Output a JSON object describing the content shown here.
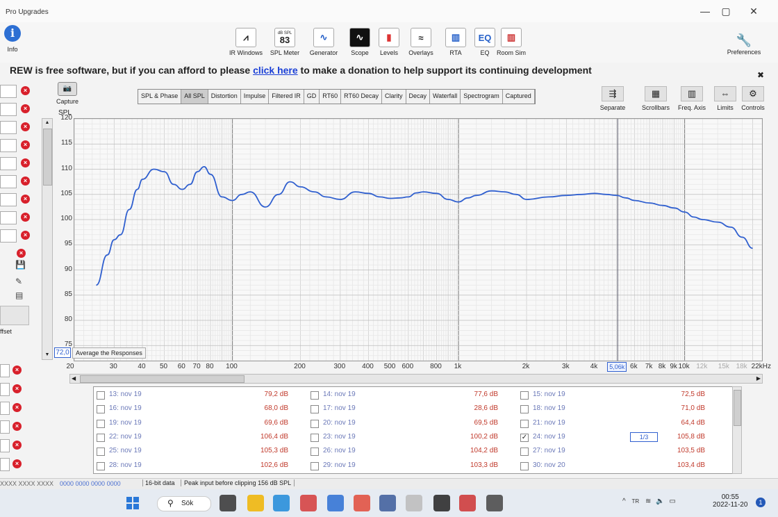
{
  "window": {
    "title": "Pro Upgrades",
    "minimize": "—",
    "maximize": "▢",
    "close": "✕"
  },
  "toolbar": {
    "info_label": "Info",
    "spl_meter": {
      "header": "dB SPL",
      "value": "83"
    },
    "items": [
      {
        "label": "IR Windows",
        "icon": "ir-windows-icon"
      },
      {
        "label": "SPL Meter",
        "icon": "spl-meter-icon"
      },
      {
        "label": "Generator",
        "icon": "generator-icon"
      },
      {
        "label": "Scope",
        "icon": "scope-icon"
      },
      {
        "label": "Levels",
        "icon": "levels-icon"
      },
      {
        "label": "Overlays",
        "icon": "overlays-icon"
      },
      {
        "label": "RTA",
        "icon": "rta-icon"
      },
      {
        "label": "EQ",
        "icon": "eq-icon"
      },
      {
        "label": "Room Sim",
        "icon": "room-sim-icon"
      }
    ],
    "preferences_label": "Preferences"
  },
  "banner": {
    "prefix": "REW is free software, but if you can afford to please ",
    "link": "click here",
    "suffix": " to make a donation to help support its continuing development",
    "close": "✖"
  },
  "capture_label": "Capture",
  "offset_label": "ffset",
  "tabs": [
    "SPL & Phase",
    "All SPL",
    "Distortion",
    "Impulse",
    "Filtered IR",
    "GD",
    "RT60",
    "RT60 Decay",
    "Clarity",
    "Decay",
    "Waterfall",
    "Spectrogram",
    "Captured"
  ],
  "active_tab": "All SPL",
  "right_tools": [
    "Separate",
    "Scrollbars",
    "Freq. Axis",
    "Limits",
    "Controls"
  ],
  "y_unit": "SPL",
  "y_offset_value": "72,0",
  "average_button": "Average the Responses",
  "cursor_freq": "5,06k",
  "table": {
    "rows": [
      [
        {
          "name": "13: nov 19",
          "value": "79,2 dB",
          "checked": false
        },
        {
          "name": "14: nov 19",
          "value": "77,6 dB",
          "checked": false
        },
        {
          "name": "15: nov 19",
          "value": "72,5 dB",
          "checked": false
        }
      ],
      [
        {
          "name": "16: nov 19",
          "value": "68,0 dB",
          "checked": false
        },
        {
          "name": "17: nov 19",
          "value": "28,6 dB",
          "checked": false
        },
        {
          "name": "18: nov 19",
          "value": "71,0 dB",
          "checked": false
        }
      ],
      [
        {
          "name": "19: nov 19",
          "value": "69,6 dB",
          "checked": false
        },
        {
          "name": "20: nov 19",
          "value": "69,5 dB",
          "checked": false
        },
        {
          "name": "21: nov 19",
          "value": "64,4 dB",
          "checked": false
        }
      ],
      [
        {
          "name": "22: nov 19",
          "value": "106,4 dB",
          "checked": false
        },
        {
          "name": "23: nov 19",
          "value": "100,2 dB",
          "checked": false
        },
        {
          "name": "24: nov 19",
          "value": "105,8 dB",
          "checked": true
        }
      ],
      [
        {
          "name": "25: nov 19",
          "value": "105,3 dB",
          "checked": false
        },
        {
          "name": "26: nov 19",
          "value": "104,2 dB",
          "checked": false
        },
        {
          "name": "27: nov 19",
          "value": "103,5 dB",
          "checked": false
        }
      ],
      [
        {
          "name": "28: nov 19",
          "value": "102,6 dB",
          "checked": false
        },
        {
          "name": "29: nov 19",
          "value": "103,3 dB",
          "checked": false
        },
        {
          "name": "30: nov 20",
          "value": "103,4 dB",
          "checked": false
        }
      ]
    ],
    "smoothing_badge": "1/3"
  },
  "status": {
    "bits": "0000 0000  0000 0000",
    "bitdepth": "16-bit data",
    "peak": "Peak input before clipping 156 dB SPL"
  },
  "taskbar": {
    "search_label": "Sök",
    "time": "00:55",
    "date": "2022-11-20",
    "notification_count": "1",
    "lang": "TR"
  },
  "chart_data": {
    "type": "line",
    "xscale": "log",
    "xlim": [
      20,
      22000
    ],
    "ylim": [
      72,
      120
    ],
    "ylabel": "SPL",
    "yticks": [
      75,
      80,
      85,
      90,
      95,
      100,
      105,
      110,
      115,
      120
    ],
    "xticks": [
      {
        "v": 20,
        "l": "20"
      },
      {
        "v": 30,
        "l": "30"
      },
      {
        "v": 40,
        "l": "40"
      },
      {
        "v": 50,
        "l": "50"
      },
      {
        "v": 60,
        "l": "60"
      },
      {
        "v": 70,
        "l": "70"
      },
      {
        "v": 80,
        "l": "80"
      },
      {
        "v": 100,
        "l": "100"
      },
      {
        "v": 200,
        "l": "200"
      },
      {
        "v": 300,
        "l": "300"
      },
      {
        "v": 400,
        "l": "400"
      },
      {
        "v": 500,
        "l": "500"
      },
      {
        "v": 600,
        "l": "600"
      },
      {
        "v": 800,
        "l": "800"
      },
      {
        "v": 1000,
        "l": "1k"
      },
      {
        "v": 2000,
        "l": "2k"
      },
      {
        "v": 3000,
        "l": "3k"
      },
      {
        "v": 4000,
        "l": "4k"
      },
      {
        "v": 6000,
        "l": "6k"
      },
      {
        "v": 7000,
        "l": "7k"
      },
      {
        "v": 8000,
        "l": "8k"
      },
      {
        "v": 9000,
        "l": "9k"
      },
      {
        "v": 10000,
        "l": "10k"
      },
      {
        "v": 12000,
        "l": "12k"
      },
      {
        "v": 15000,
        "l": "15k"
      },
      {
        "v": 18000,
        "l": "18k"
      },
      {
        "v": 22000,
        "l": "22kHz"
      }
    ],
    "cursor_x": 5060,
    "series_color": "#2f5fcf",
    "series": [
      {
        "x": [
          25,
          28,
          30,
          32,
          35,
          38,
          40,
          45,
          50,
          55,
          60,
          65,
          70,
          75,
          80,
          90,
          100,
          110,
          120,
          140,
          160,
          180,
          200,
          230,
          260,
          300,
          350,
          400,
          450,
          500,
          550,
          600,
          650,
          700,
          800,
          900,
          1000,
          1100,
          1200,
          1400,
          1600,
          1800,
          2000,
          2500,
          3000,
          3500,
          4000,
          4500,
          5000,
          5500,
          6000,
          7000,
          8000,
          9000,
          10000,
          11000,
          12000,
          14000,
          16000,
          18000,
          20000
        ],
        "y": [
          87,
          93,
          96,
          97,
          102,
          106,
          108,
          110,
          109.5,
          107,
          106,
          107,
          109.5,
          110.5,
          109,
          104.5,
          103.8,
          105,
          105.5,
          102.5,
          105,
          107.5,
          106.5,
          105.5,
          104.5,
          104,
          105.5,
          105.2,
          104.5,
          104.2,
          104.3,
          104.5,
          105.3,
          105.5,
          105.2,
          104,
          103.5,
          104.3,
          104.8,
          105.7,
          105.5,
          105,
          104,
          104.5,
          104.8,
          105,
          105.2,
          105,
          104.8,
          104.3,
          103.8,
          103.3,
          102.8,
          102.3,
          101.5,
          100.5,
          100,
          99.5,
          98.5,
          96.5,
          94.3
        ]
      }
    ]
  }
}
